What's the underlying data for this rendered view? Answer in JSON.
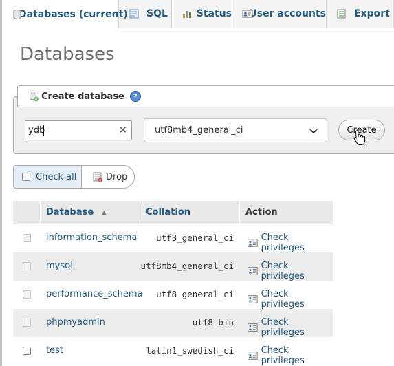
{
  "tabs": [
    {
      "label": "Databases (current)",
      "icon": "database-icon",
      "active": true
    },
    {
      "label": "SQL",
      "icon": "sql-icon"
    },
    {
      "label": "Status",
      "icon": "status-chart-icon"
    },
    {
      "label": "User accounts",
      "icon": "user-accounts-icon"
    },
    {
      "label": "Export",
      "icon": "export-icon"
    }
  ],
  "page": {
    "title": "Databases"
  },
  "create_db": {
    "legend": "Create database",
    "name_value": "ydb",
    "collation_value": "utf8mb4_general_ci",
    "create_label": "Create"
  },
  "actions": {
    "check_all": "Check all",
    "drop": "Drop"
  },
  "table": {
    "headers": {
      "database": "Database",
      "sort_indicator": "▲",
      "collation": "Collation",
      "action": "Action"
    },
    "rows": [
      {
        "database": "information_schema",
        "collation": "utf8_general_ci",
        "action": "Check privileges"
      },
      {
        "database": "mysql",
        "collation": "utf8mb4_general_ci",
        "action": "Check privileges"
      },
      {
        "database": "performance_schema",
        "collation": "utf8_general_ci",
        "action": "Check privileges"
      },
      {
        "database": "phpmyadmin",
        "collation": "utf8_bin",
        "action": "Check privileges"
      },
      {
        "database": "test",
        "collation": "latin1_swedish_ci",
        "action": "Check privileges"
      }
    ]
  },
  "colors": {
    "link": "#235a81",
    "title": "#707070"
  }
}
